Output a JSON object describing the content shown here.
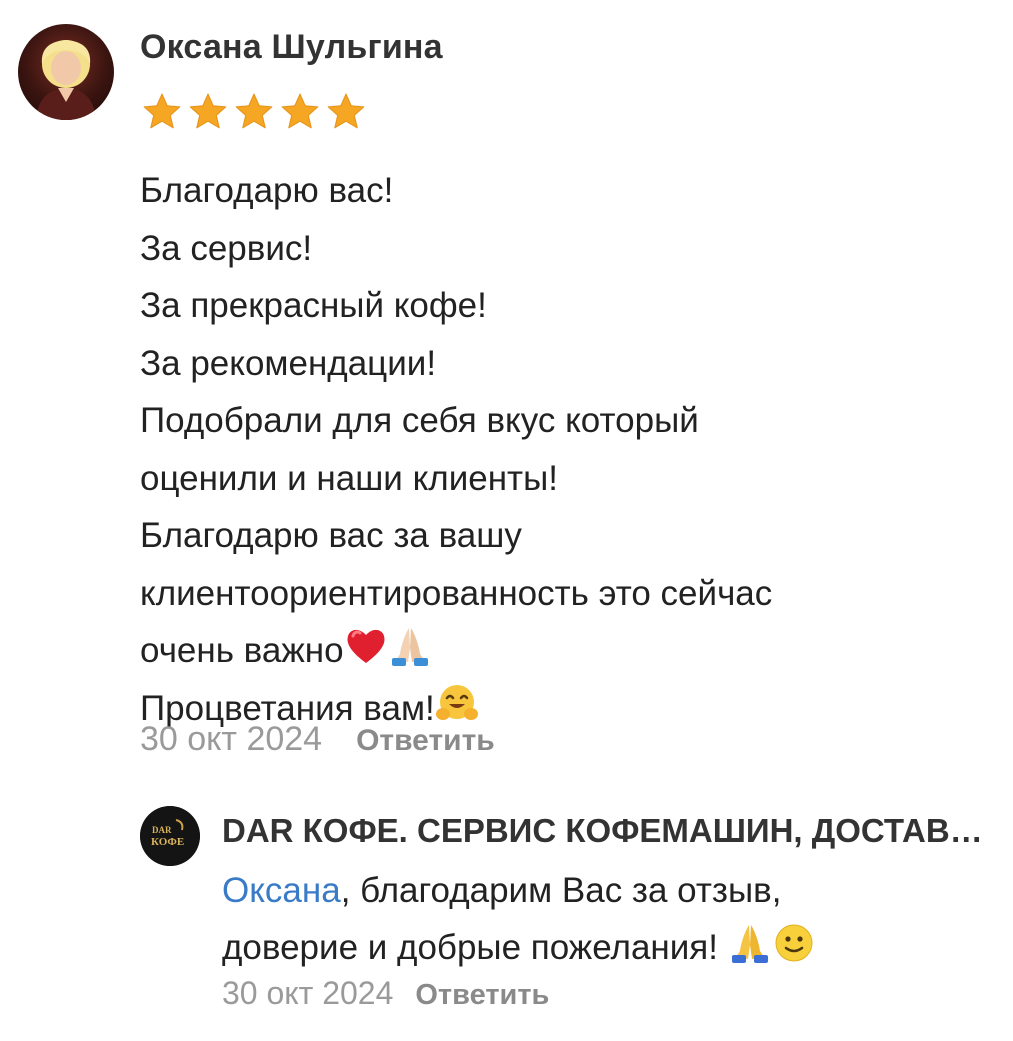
{
  "review": {
    "author": "Оксана Шульгина",
    "rating": 5,
    "rating_max": 5,
    "star_color": "#f5a623",
    "lines": [
      "Благодарю вас!",
      "За сервис!",
      "За прекрасный кофе!",
      "За рекомендации!",
      "Подобрали для себя вкус который",
      "оценили и наши клиенты!",
      "Благодарю вас за вашу",
      "клиентоориентированность это сейчас",
      "очень важно",
      "Процветания вам!"
    ],
    "emojis": {
      "line9": [
        "red-heart",
        "praying-hands"
      ],
      "line10": [
        "hugging-face"
      ]
    },
    "date": "30 окт 2024",
    "reply_label": "Ответить"
  },
  "reply": {
    "author": "DAR КОФЕ. СЕРВИС КОФЕМАШИН, ДОСТАВКА КОФЕ",
    "avatar_text_top": "DAR",
    "avatar_text_bottom": "КОФЕ",
    "mention": "Оксана",
    "text_part1": ", благодарим Вас за отзыв,",
    "text_part2": "доверие и добрые пожелания!",
    "emojis": [
      "praying-hands",
      "slightly-smiling-face"
    ],
    "date": "30 окт 2024",
    "reply_label": "Ответить",
    "mention_color": "#3a7bc8"
  }
}
